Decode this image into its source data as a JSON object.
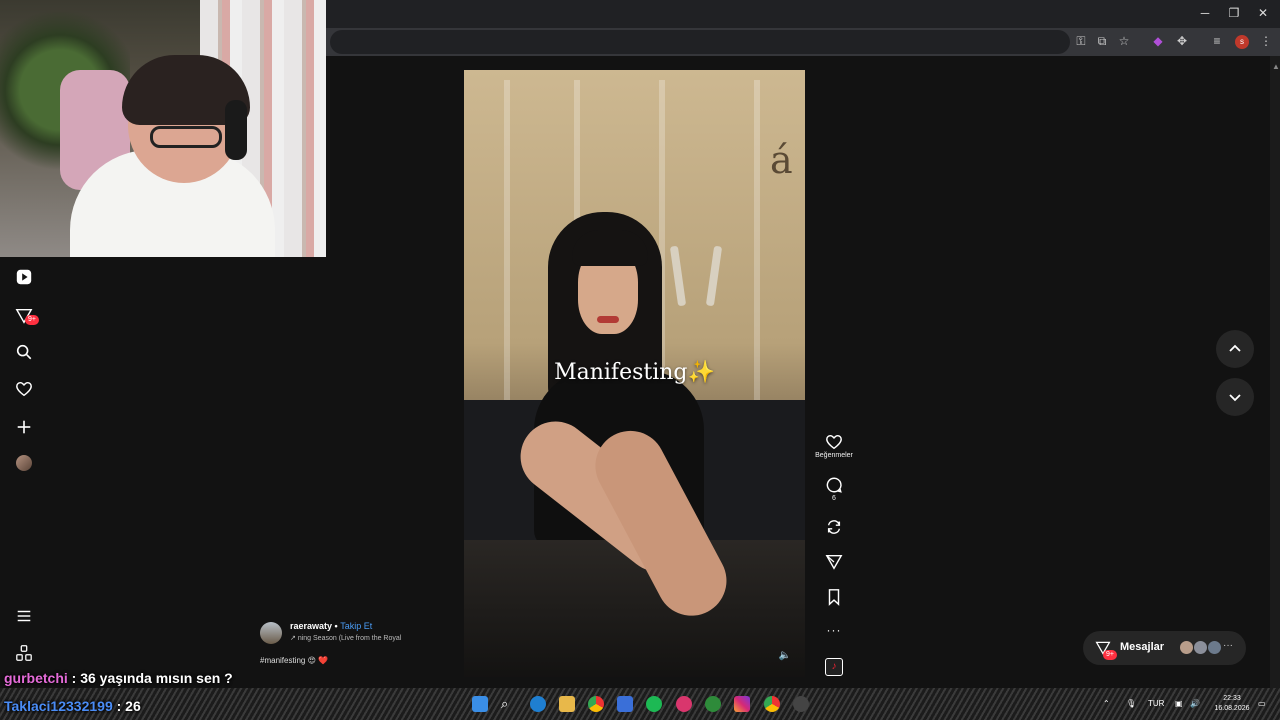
{
  "window": {
    "minimize": "─",
    "restore": "❐",
    "close": "✕"
  },
  "toolbar": {
    "profile_initial": "s"
  },
  "nav": {
    "notification_badge": "9+"
  },
  "video": {
    "overlay_text": "Manifesting",
    "overlay_emoji": "✨",
    "wall_letter": "á"
  },
  "actions": {
    "like_label": "Beğenmeler",
    "comment_count": "6"
  },
  "caption": {
    "username": "raerawaty",
    "separator": " • ",
    "follow_label": "Takip Et",
    "music_prefix": "↗",
    "music_text": "ning Season (Live from the Royal",
    "hashtag": "#manifesting",
    "emojis": "😍 ❤️"
  },
  "messages": {
    "label": "Mesajlar",
    "badge": "9+",
    "more": "···"
  },
  "chat": [
    {
      "user": "gurbetchi",
      "message": " : 36 yaşında mısın sen ?"
    },
    {
      "user": "Taklaci12332199",
      "message": " : 26"
    }
  ],
  "taskbar": {
    "language": "TUR",
    "time": "22:33",
    "date": "16.08.2026"
  },
  "colors": {
    "page_bg": "#121212",
    "accent_link": "#4a9cf5",
    "badge": "#ff3040"
  }
}
